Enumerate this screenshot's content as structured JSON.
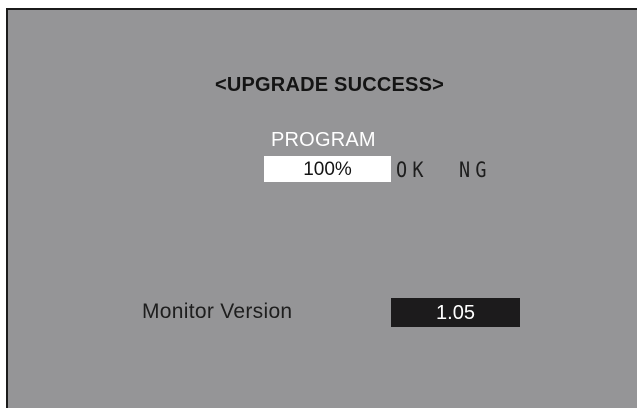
{
  "screen": {
    "title": "<UPGRADE SUCCESS>",
    "program": {
      "label": "PROGRAM",
      "progress_text": "100%",
      "progress_value": 1.0,
      "ok_label": "OK",
      "ng_label": "NG"
    },
    "monitor_version": {
      "label": "Monitor Version",
      "value": "1.05"
    }
  },
  "colors": {
    "background": "#959597",
    "border": "#1b1b1b",
    "progress_bg": "#ffffff",
    "version_bg": "#1c1b1c"
  }
}
